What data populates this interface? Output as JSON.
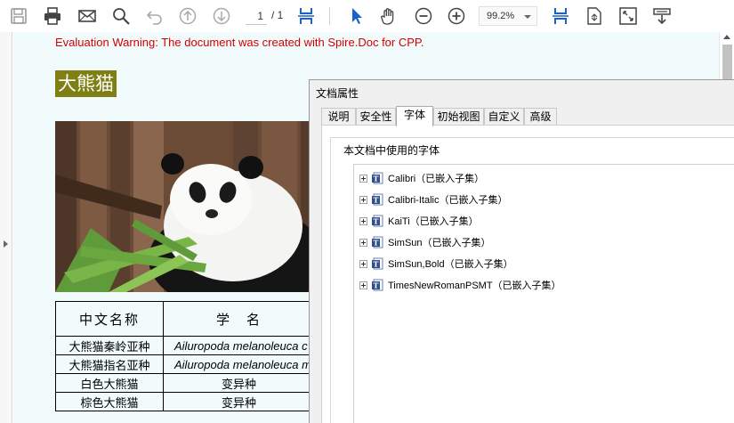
{
  "toolbar": {
    "page_current": "1",
    "page_total": "/ 1",
    "zoom": "99.2%",
    "icons": [
      "save-icon",
      "print-icon",
      "email-icon",
      "search-icon",
      "undo-icon",
      "page-up-icon",
      "page-down-icon",
      "fit-width-icon",
      "select-cursor-icon",
      "hand-icon",
      "zoom-out-icon",
      "zoom-in-icon",
      "fit-page-icon",
      "page-properties-icon",
      "fullscreen-icon",
      "download-icon"
    ],
    "accent": "#1a62c8"
  },
  "document": {
    "warning": "Evaluation Warning: The document was created with Spire.Doc for CPP.",
    "title": "大熊猫",
    "table": {
      "header": [
        "中文名称",
        "学　名"
      ],
      "rows": [
        [
          "大熊猫秦岭亚种",
          "Ailuropoda melanoleuca c"
        ],
        [
          "大熊猫指名亚种",
          "Ailuropoda melanoleuca m"
        ],
        [
          "白色大熊猫",
          "变异种"
        ],
        [
          "棕色大熊猫",
          "变异种"
        ]
      ]
    }
  },
  "dialog": {
    "title": "文档属性",
    "tabs": [
      "说明",
      "安全性",
      "字体",
      "初始视图",
      "自定义",
      "高级"
    ],
    "active_tab": "字体",
    "group_label": "本文档中使用的字体",
    "fonts": [
      "Calibri（已嵌入子集）",
      "Calibri-Italic（已嵌入子集）",
      "KaiTi（已嵌入子集）",
      "SimSun（已嵌入子集）",
      "SimSun,Bold（已嵌入子集）",
      "TimesNewRomanPSMT（已嵌入子集）"
    ]
  }
}
